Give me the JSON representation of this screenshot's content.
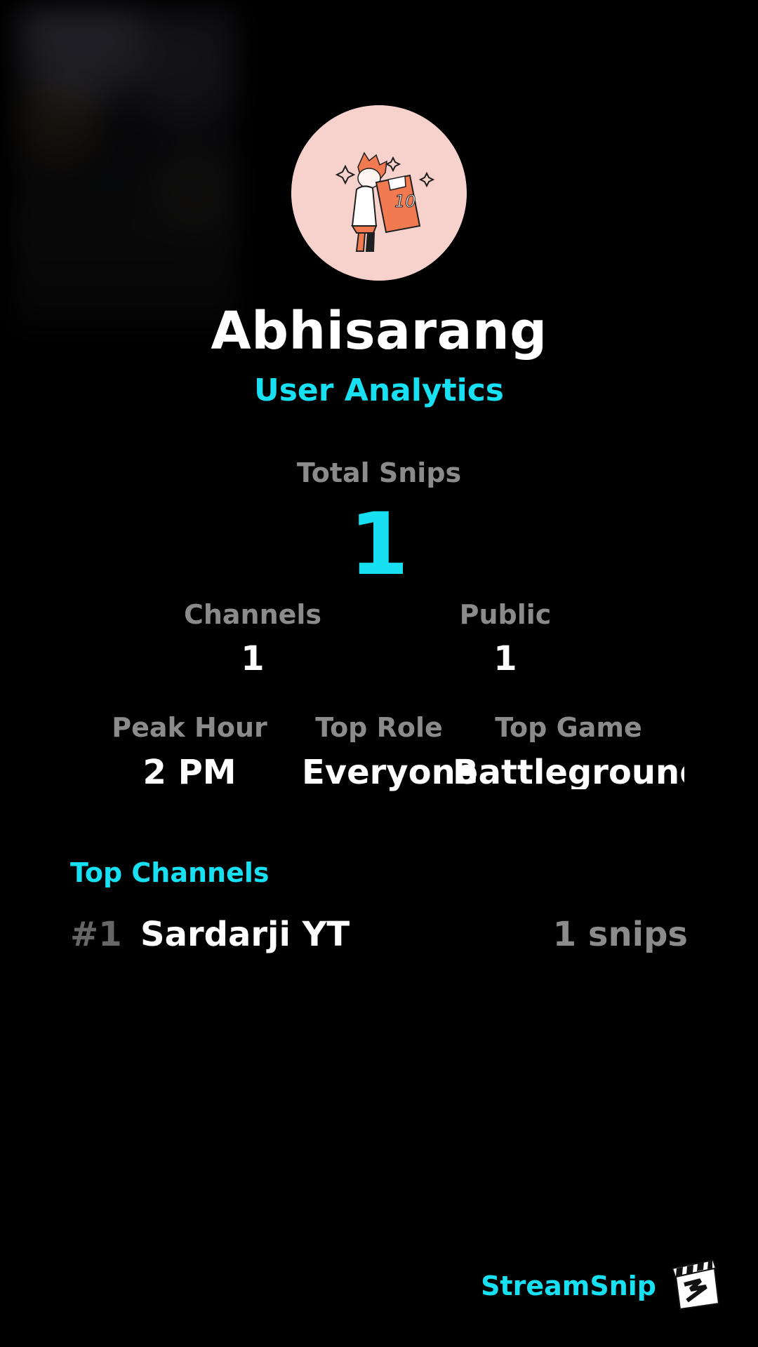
{
  "profile": {
    "username": "Abhisarang",
    "subtitle": "User Analytics",
    "avatar_icon": "avatar-icon"
  },
  "stats": {
    "total_snips_label": "Total Snips",
    "total_snips_value": "1",
    "channels_label": "Channels",
    "channels_value": "1",
    "public_label": "Public",
    "public_value": "1",
    "peak_hour_label": "Peak Hour",
    "peak_hour_value": "2 PM",
    "top_role_label": "Top Role",
    "top_role_value": "Everyone",
    "top_game_label": "Top Game",
    "top_game_value": "Battleground.."
  },
  "top_channels": {
    "title": "Top Channels",
    "items": [
      {
        "rank": "#1",
        "name": "Sardarji YT",
        "snips": "1 snips"
      }
    ]
  },
  "branding": {
    "name": "StreamSnip",
    "icon": "clapperboard-icon"
  },
  "colors": {
    "background": "#000000",
    "accent": "#16E0F2",
    "muted_text": "#8B8B8B"
  }
}
